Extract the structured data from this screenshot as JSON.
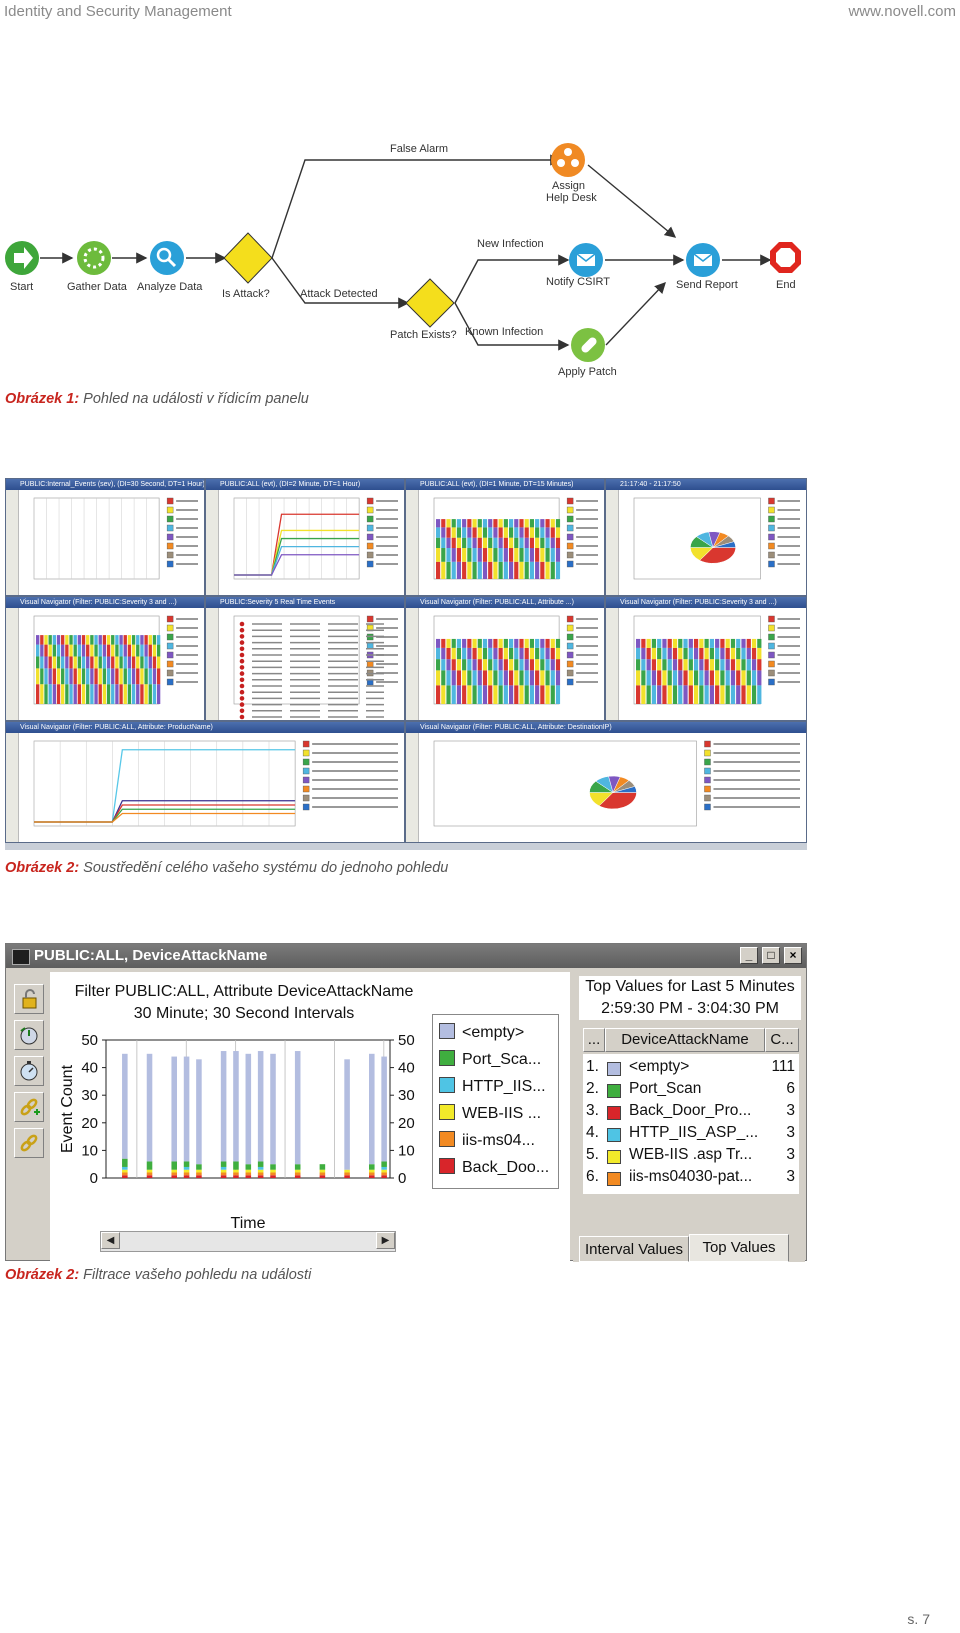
{
  "header": {
    "left": "Identity and Security Management",
    "right": "www.novell.com"
  },
  "flow": {
    "nodes": {
      "start": "Start",
      "gather": "Gather Data",
      "analyze": "Analyze Data",
      "is_attack": "Is Attack?",
      "attack_detected": "Attack Detected",
      "false_alarm": "False Alarm",
      "assign1": "Assign",
      "assign2": "Help Desk",
      "new_infection": "New Infection",
      "notify": "Notify CSIRT",
      "send_report": "Send Report",
      "end": "End",
      "patch_exists": "Patch Exists?",
      "known_infection": "Known Infection",
      "apply_patch": "Apply Patch"
    }
  },
  "captions": [
    {
      "label": "Obrázek 1:",
      "text": " Pohled na události v řídicím panelu"
    },
    {
      "label": "Obrázek 2:",
      "text": " Soustředění celého vašeho systému do jednoho pohledu"
    },
    {
      "label": "Obrázek 2:",
      "text": " Filtrace vašeho pohledu na události"
    }
  ],
  "collage": {
    "panes": [
      {
        "title": "PUBLIC:Internal_Events (sev), (DI=30 Second, DT=1 Hour)"
      },
      {
        "title": "PUBLIC:ALL (evt), (DI=2 Minute, DT=1 Hour)"
      },
      {
        "title": "PUBLIC:ALL (evt), (DI=1 Minute, DT=15 Minutes)"
      },
      {
        "title": "21:17:40 - 21:17:50"
      },
      {
        "title": "Visual Navigator (Filter: PUBLIC:Severity 3 and ...)"
      },
      {
        "title": "PUBLIC:Severity 5 Real Time Events"
      },
      {
        "title": "Visual Navigator (Filter: PUBLIC:ALL, Attribute ...)"
      },
      {
        "title": "Visual Navigator (Filter: PUBLIC:Severity 3 and ...)"
      },
      {
        "title": "Visual Navigator (Filter: PUBLIC:ALL, Attribute: ProductName)"
      },
      {
        "title": "Visual Navigator (Filter: PUBLIC:ALL, Attribute: DestinationIP)"
      }
    ]
  },
  "window": {
    "title": "PUBLIC:ALL, DeviceAttackName",
    "chart_title_line1": "Filter PUBLIC:ALL, Attribute DeviceAttackName",
    "chart_title_line2": "30 Minute; 30 Second Intervals",
    "ylabel": "Event Count",
    "xlabel": "Time",
    "top_header_line1": "Top Values for Last 5 Minutes",
    "top_header_line2": "2:59:30 PM - 3:04:30 PM",
    "col_dots": "...",
    "col_name": "DeviceAttackName",
    "col_count": "C...",
    "tab_interval": "Interval Values",
    "tab_top": "Top Values",
    "legend": [
      {
        "label": "<empty>",
        "color": "#b3bde0"
      },
      {
        "label": "Port_Sca...",
        "color": "#3fae3f"
      },
      {
        "label": "HTTP_IIS...",
        "color": "#4fc4e4"
      },
      {
        "label": "WEB-IIS ...",
        "color": "#f2ea2a"
      },
      {
        "label": "iis-ms04...",
        "color": "#f28a22"
      },
      {
        "label": "Back_Doo...",
        "color": "#d8252a"
      }
    ],
    "top_values": [
      {
        "rank": "1.",
        "name": "<empty>",
        "count": "111",
        "color": "#b3bde0"
      },
      {
        "rank": "2.",
        "name": "Port_Scan",
        "count": "6",
        "color": "#3fae3f"
      },
      {
        "rank": "3.",
        "name": "Back_Door_Pro...",
        "count": "3",
        "color": "#d8252a"
      },
      {
        "rank": "4.",
        "name": "HTTP_IIS_ASP_...",
        "count": "3",
        "color": "#4fc4e4"
      },
      {
        "rank": "5.",
        "name": "WEB-IIS .asp Tr...",
        "count": "3",
        "color": "#f2ea2a"
      },
      {
        "rank": "6.",
        "name": "iis-ms04030-pat...",
        "count": "3",
        "color": "#f28a22"
      }
    ]
  },
  "chart_data": {
    "type": "bar",
    "title": "Filter PUBLIC:ALL, Attribute DeviceAttackName",
    "subtitle": "30 Minute; 30 Second Intervals",
    "xlabel": "Time",
    "ylabel": "Event Count",
    "ylim": [
      0,
      50
    ],
    "yticks": [
      0,
      10,
      20,
      30,
      40,
      50
    ],
    "series": [
      {
        "name": "<empty>",
        "values": [
          0,
          38,
          0,
          39,
          0,
          38,
          38,
          38,
          0,
          40,
          40,
          40,
          40,
          40,
          0,
          41,
          0,
          0,
          0,
          40,
          0,
          40,
          38
        ]
      },
      {
        "name": "Port_Sca...",
        "values": [
          0,
          3,
          0,
          3,
          0,
          3,
          2,
          2,
          0,
          2,
          3,
          2,
          2,
          2,
          0,
          2,
          0,
          2,
          0,
          0,
          0,
          2,
          2
        ]
      },
      {
        "name": "HTTP_IIS...",
        "values": [
          0,
          1,
          0,
          0,
          0,
          0,
          1,
          0,
          0,
          1,
          0,
          0,
          1,
          0,
          0,
          0,
          0,
          0,
          0,
          0,
          0,
          0,
          1
        ]
      },
      {
        "name": "WEB-IIS ...",
        "values": [
          0,
          1,
          0,
          1,
          0,
          1,
          1,
          1,
          0,
          1,
          1,
          1,
          1,
          1,
          0,
          1,
          0,
          1,
          0,
          1,
          0,
          1,
          1
        ]
      },
      {
        "name": "iis-ms04...",
        "values": [
          0,
          1,
          0,
          1,
          0,
          1,
          1,
          1,
          0,
          1,
          1,
          1,
          1,
          1,
          0,
          1,
          0,
          1,
          0,
          1,
          0,
          1,
          1
        ]
      },
      {
        "name": "Back_Doo...",
        "values": [
          0,
          1,
          0,
          1,
          0,
          1,
          1,
          1,
          0,
          1,
          1,
          1,
          1,
          1,
          0,
          1,
          0,
          1,
          0,
          1,
          0,
          1,
          1
        ]
      }
    ]
  },
  "page_number": "s. 7"
}
